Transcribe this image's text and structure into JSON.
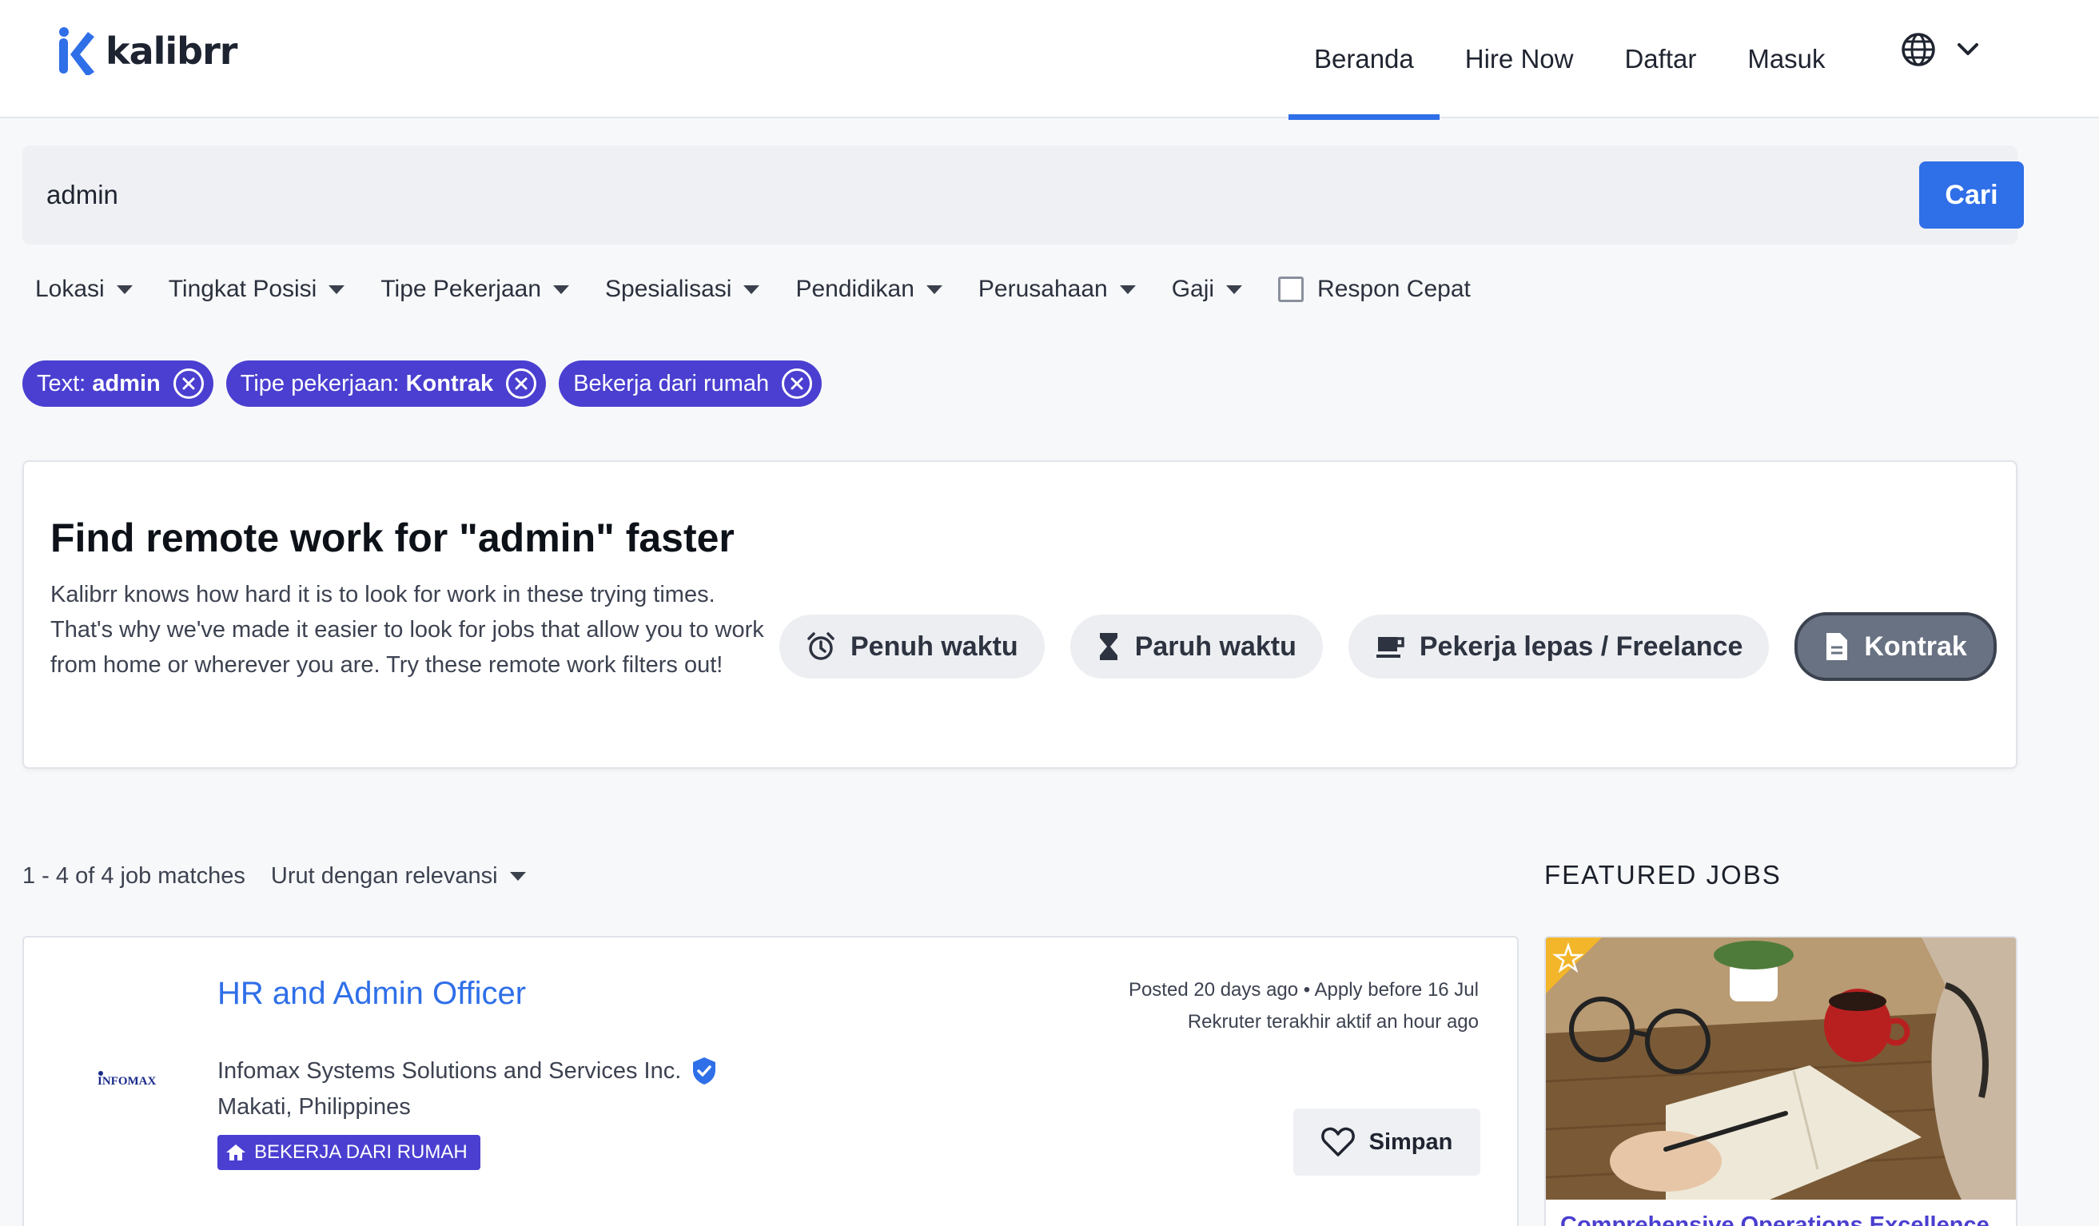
{
  "header": {
    "brand": "kalibrr",
    "nav": [
      "Beranda",
      "Hire Now",
      "Daftar",
      "Masuk"
    ],
    "active_nav": "Beranda",
    "language_icon": "globe-icon",
    "accent_color": "#2f6fe8"
  },
  "search": {
    "query": "admin",
    "button": "Cari"
  },
  "filters": {
    "items": [
      "Lokasi",
      "Tingkat Posisi",
      "Tipe Pekerjaan",
      "Spesialisasi",
      "Pendidikan",
      "Perusahaan",
      "Gaji"
    ],
    "quick_response": {
      "label": "Respon Cepat",
      "checked": false
    }
  },
  "active_chips": [
    {
      "prefix": "Text: ",
      "value": "admin"
    },
    {
      "prefix": "Tipe pekerjaan: ",
      "value": "Kontrak"
    },
    {
      "prefix": "",
      "value": "Bekerja dari rumah"
    }
  ],
  "remote_card": {
    "title": "Find remote work for \"admin\" faster",
    "description": "Kalibrr knows how hard it is to look for work in these trying times. That's why we've made it easier to look for jobs that allow you to work from home or wherever you are. Try these remote work filters out!",
    "options": [
      {
        "label": "Penuh waktu",
        "icon": "alarm-clock-icon",
        "selected": false
      },
      {
        "label": "Paruh waktu",
        "icon": "hourglass-icon",
        "selected": false
      },
      {
        "label": "Pekerja lepas / Freelance",
        "icon": "coffee-cup-icon",
        "selected": false
      },
      {
        "label": "Kontrak",
        "icon": "document-icon",
        "selected": true
      }
    ]
  },
  "results": {
    "count_text": "1 - 4 of 4 job matches",
    "sort_label": "Urut dengan relevansi"
  },
  "featured": {
    "heading": "FEATURED JOBS",
    "title": "Comprehensive Operations Excellence"
  },
  "job": {
    "title": "HR and Admin Officer",
    "company": "Infomax Systems Solutions and Services Inc.",
    "company_logo_text": "INFOMAX",
    "location": "Makati, Philippines",
    "badge": "BEKERJA DARI RUMAH",
    "posted": "Posted 20 days ago • Apply before 16 Jul",
    "recruiter_active": "Rekruter terakhir aktif an hour ago",
    "save_label": "Simpan",
    "badge_color": "#4a3fd0"
  }
}
